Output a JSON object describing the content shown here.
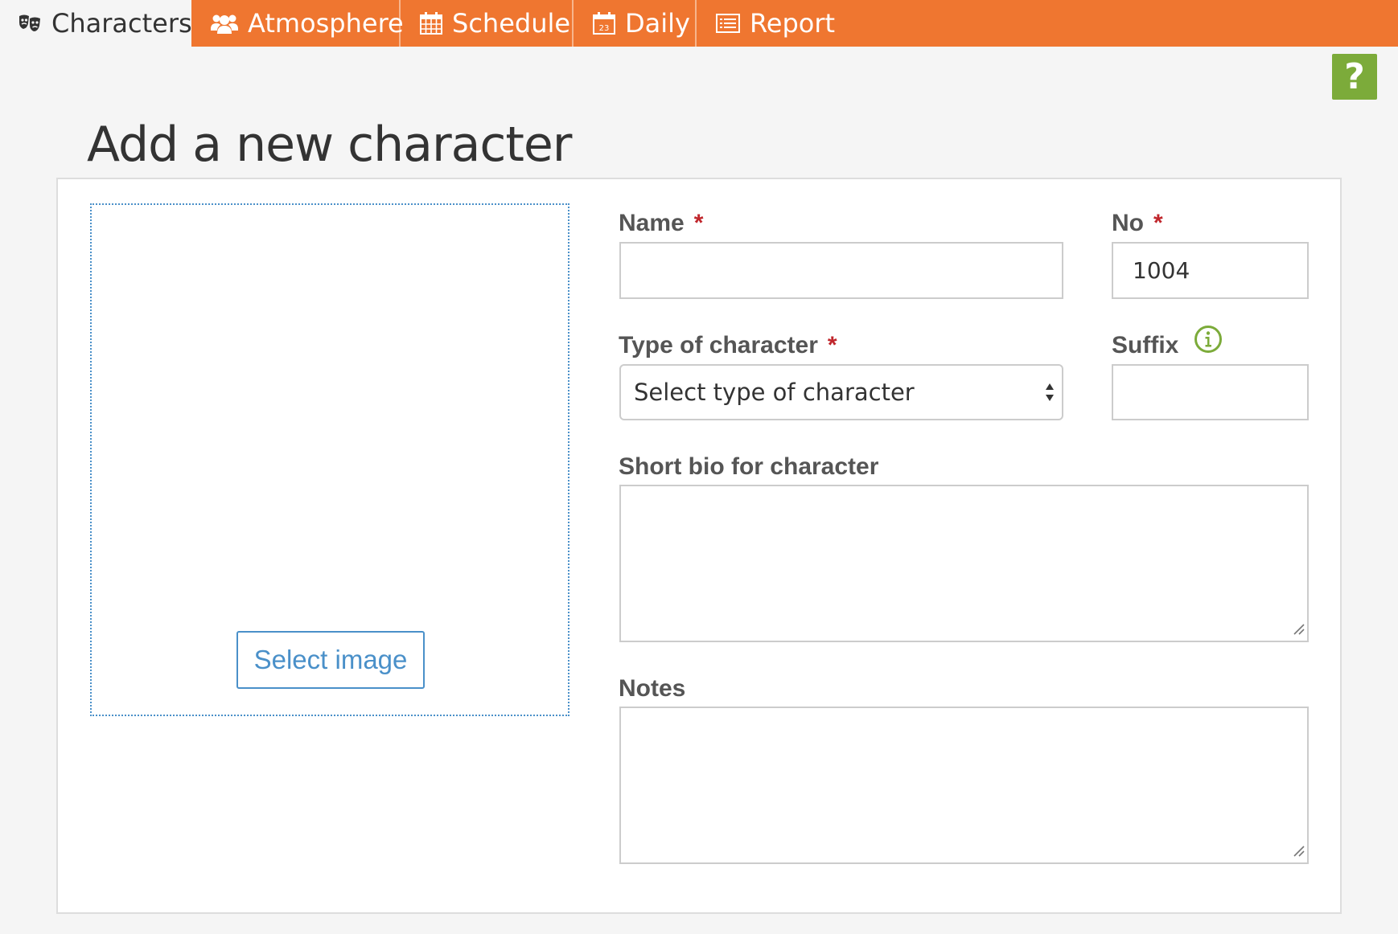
{
  "nav": {
    "tabs": [
      {
        "label": "Characters",
        "icon": "theater-masks-icon",
        "active": true
      },
      {
        "label": "Atmosphere",
        "icon": "users-icon",
        "active": false
      },
      {
        "label": "Schedule",
        "icon": "calendar-grid-icon",
        "active": false
      },
      {
        "label": "Daily",
        "icon": "calendar-day-icon",
        "active": false
      },
      {
        "label": "Report",
        "icon": "report-list-icon",
        "active": false
      }
    ],
    "tab_active_bg": "#f5f5f5",
    "bar_color": "#ef7630"
  },
  "help": {
    "label": "?",
    "color": "#7cab3a",
    "icon": "help-icon"
  },
  "page": {
    "title": "Add a new character"
  },
  "form": {
    "image": {
      "button_label": "Select image",
      "accent": "#4a90c9"
    },
    "name": {
      "label": "Name",
      "required_mark": "*",
      "value": ""
    },
    "no": {
      "label": "No",
      "required_mark": "*",
      "value": "1004"
    },
    "type": {
      "label": "Type of character",
      "required_mark": "*",
      "selected": "Select type of character"
    },
    "suffix": {
      "label": "Suffix",
      "value": "",
      "info_icon": "info-circle-icon",
      "info_color": "#7cab3a"
    },
    "bio": {
      "label": "Short bio for character",
      "value": ""
    },
    "notes": {
      "label": "Notes",
      "value": ""
    }
  }
}
